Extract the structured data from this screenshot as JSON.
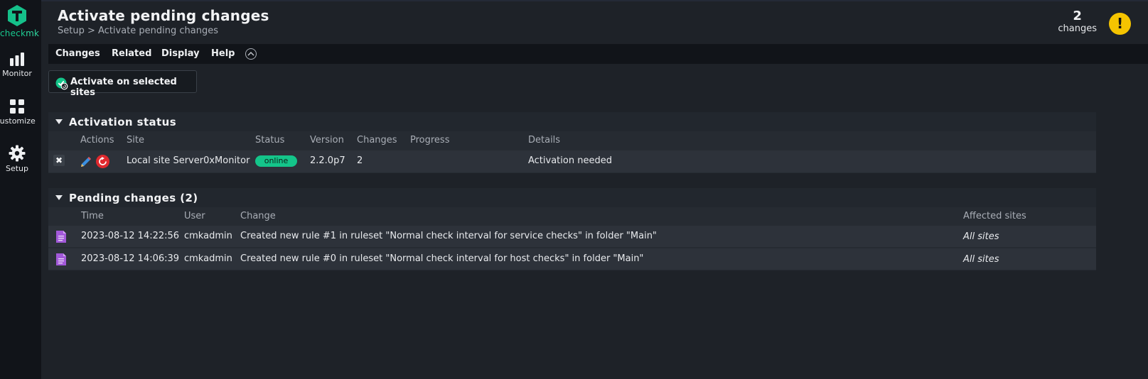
{
  "sidebar": {
    "logo_text_a": "check",
    "logo_text_b": "mk",
    "items": [
      {
        "label": "Monitor"
      },
      {
        "label": "Customize"
      },
      {
        "label": "Setup"
      }
    ]
  },
  "header": {
    "title": "Activate pending changes",
    "breadcrumb": {
      "root": "Setup",
      "separator": " > ",
      "current": "Activate pending changes"
    },
    "changes_count": "2",
    "changes_label": "changes",
    "warning_icon": "exclamation-icon"
  },
  "menu": {
    "items": [
      "Changes",
      "Related",
      "Display",
      "Help"
    ]
  },
  "activate_button": {
    "label": "Activate on selected sites"
  },
  "activation_status": {
    "title": "Activation status",
    "columns": [
      "Actions",
      "Site",
      "Status",
      "Version",
      "Changes",
      "Progress",
      "Details"
    ],
    "rows": [
      {
        "site": "Local site Server0xMonitor",
        "status": "online",
        "version": "2.2.0p7",
        "changes": "2",
        "progress": "",
        "details": "Activation needed"
      }
    ]
  },
  "pending_changes": {
    "title": "Pending changes (2)",
    "columns": [
      "Time",
      "User",
      "Change",
      "Affected sites"
    ],
    "rows": [
      {
        "time": "2023-08-12 14:22:56",
        "user": "cmkadmin",
        "change": "Created new rule #1 in ruleset \"Normal check interval for service checks\" in folder \"Main\"",
        "affected": "All sites"
      },
      {
        "time": "2023-08-12 14:06:39",
        "user": "cmkadmin",
        "change": "Created new rule #0 in ruleset \"Normal check interval for host checks\" in folder \"Main\"",
        "affected": "All sites"
      }
    ]
  },
  "colors": {
    "accent": "#18c98f",
    "warning": "#f5c400",
    "online_badge": "#14c58a",
    "restart": "#e0292e",
    "doc_icon": "#a259d9"
  }
}
